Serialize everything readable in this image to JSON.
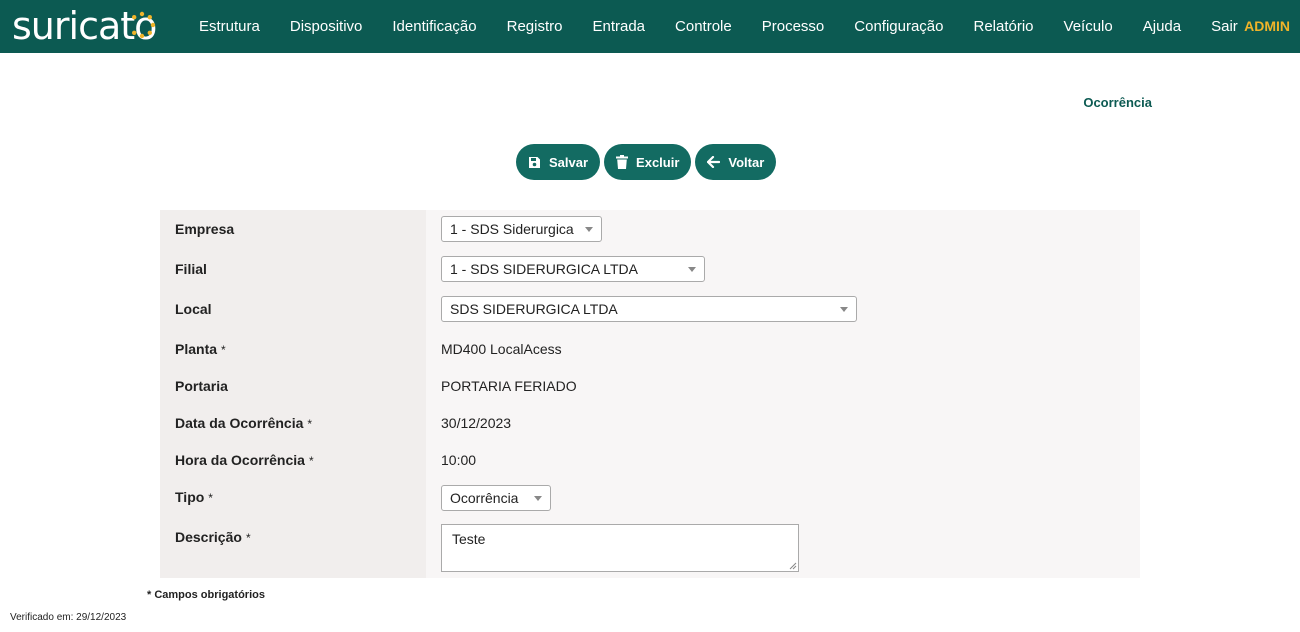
{
  "app": {
    "logo_text": "suricato",
    "nav": [
      "Estrutura",
      "Dispositivo",
      "Identificação",
      "Registro",
      "Entrada",
      "Controle",
      "Processo",
      "Configuração",
      "Relatório",
      "Veículo",
      "Ajuda",
      "Sair"
    ],
    "user": "ADMIN",
    "brand_color": "#0c5a52",
    "accent_color": "#f0b429"
  },
  "page": {
    "title": "Ocorrência"
  },
  "toolbar": {
    "save_label": "Salvar",
    "delete_label": "Excluir",
    "back_label": "Voltar",
    "save_icon": "floppy-disk-icon",
    "delete_icon": "trash-icon",
    "back_icon": "arrow-left-icon"
  },
  "form": {
    "empresa": {
      "label": "Empresa",
      "value": "1 - SDS Siderurgica"
    },
    "filial": {
      "label": "Filial",
      "value": "1 - SDS SIDERURGICA LTDA"
    },
    "local": {
      "label": "Local",
      "value": "SDS SIDERURGICA LTDA"
    },
    "planta": {
      "label": "Planta",
      "required": "*",
      "value": "MD400 LocalAcess"
    },
    "portaria": {
      "label": "Portaria",
      "value": "PORTARIA FERIADO"
    },
    "data": {
      "label": "Data da Ocorrência",
      "required": "*",
      "value": "30/12/2023"
    },
    "hora": {
      "label": "Hora da Ocorrência",
      "required": "*",
      "value": "10:00"
    },
    "tipo": {
      "label": "Tipo",
      "required": "*",
      "value": "Ocorrência"
    },
    "descricao": {
      "label": "Descrição",
      "required": "*",
      "value": "Teste"
    }
  },
  "footer": {
    "required_note": "* Campos obrigatórios",
    "verified": "Verificado em: 29/12/2023"
  }
}
